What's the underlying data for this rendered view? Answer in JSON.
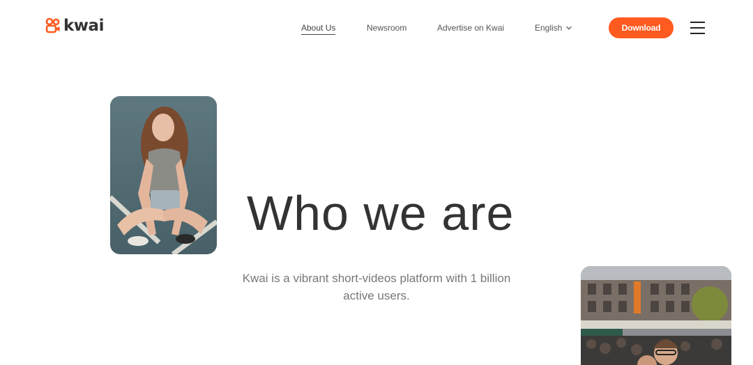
{
  "header": {
    "logo_text": "kwai",
    "nav": {
      "about": "About Us",
      "newsroom": "Newsroom",
      "advertise": "Advertise on Kwai",
      "language": "English"
    },
    "download_label": "Download"
  },
  "hero": {
    "title": "Who we are",
    "description": "Kwai is a vibrant short-videos platform with 1 billion active users."
  },
  "colors": {
    "accent": "#ff5a1f",
    "text": "#333333",
    "muted": "#777777"
  },
  "icons": {
    "logo": "kwai-logo-icon",
    "language_dropdown": "chevron-down-icon",
    "menu": "hamburger-menu-icon"
  }
}
